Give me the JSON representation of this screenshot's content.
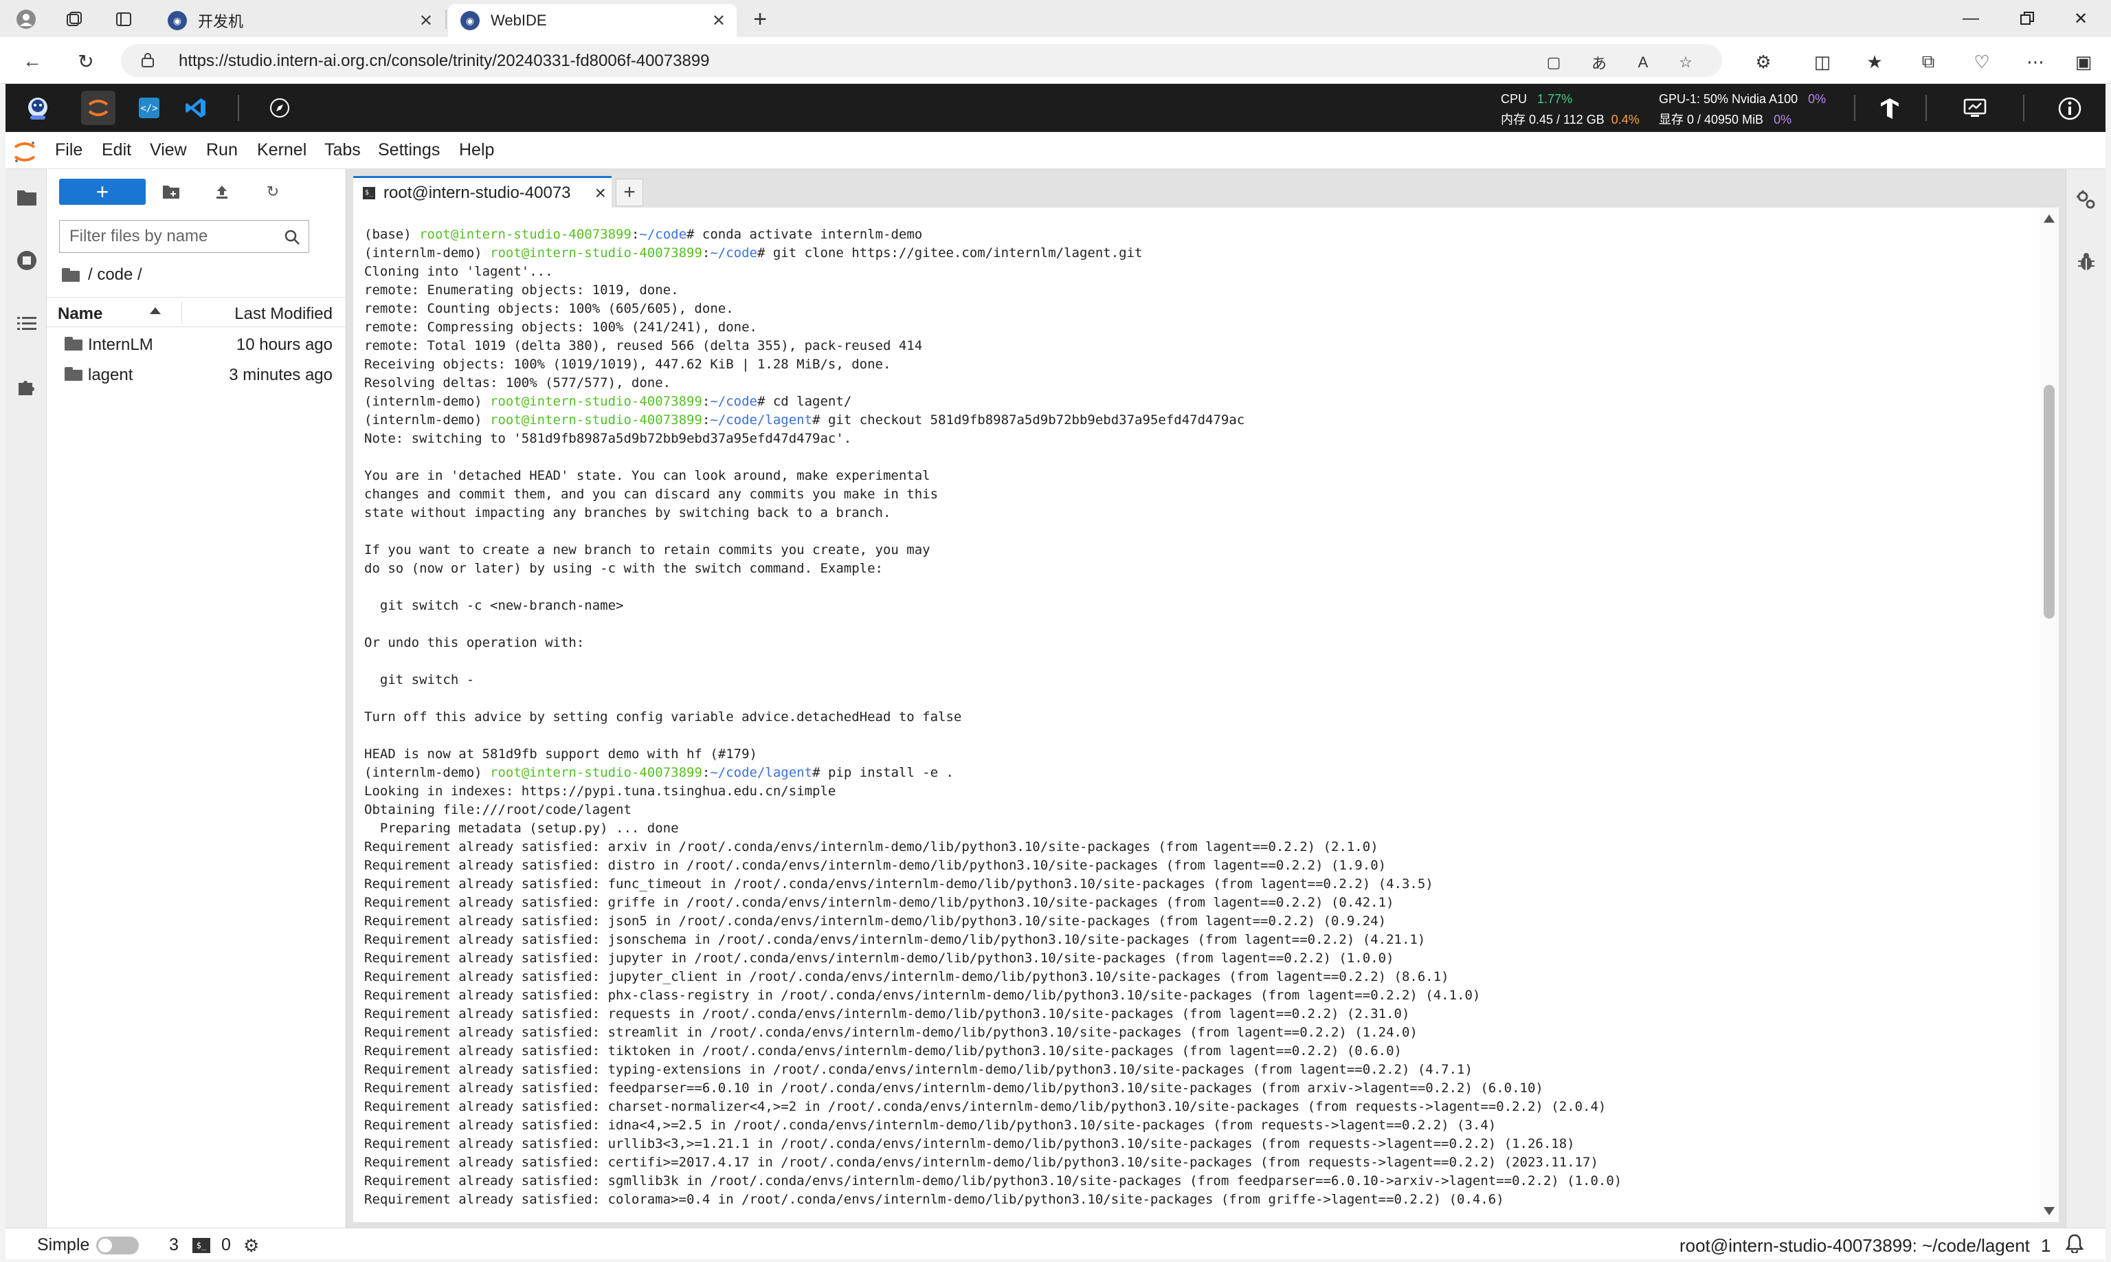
{
  "browser": {
    "tabs": [
      {
        "title": "开发机",
        "active": false
      },
      {
        "title": "WebIDE",
        "active": true
      }
    ],
    "url": "https://studio.intern-ai.org.cn/console/trinity/20240331-fd8006f-40073899"
  },
  "header": {
    "cpu_label": "CPU",
    "cpu_value": "1.77%",
    "mem_label": "内存 0.45 / 112 GB",
    "mem_value": "0.4%",
    "gpu_label": "GPU-1: 50% Nvidia A100",
    "gpu_value": "0%",
    "vram_label": "显存 0 / 40950 MiB",
    "vram_value": "0%"
  },
  "menubar": {
    "items": [
      "File",
      "Edit",
      "View",
      "Run",
      "Kernel",
      "Tabs",
      "Settings",
      "Help"
    ]
  },
  "filebrowser": {
    "new_label": "+",
    "filter_placeholder": "Filter files by name",
    "breadcrumb": "/ code /",
    "col_name": "Name",
    "col_modified": "Last Modified",
    "items": [
      {
        "name": "InternLM",
        "modified": "10 hours ago"
      },
      {
        "name": "lagent",
        "modified": "3 minutes ago"
      }
    ]
  },
  "terminal": {
    "tab_title": "root@intern-studio-40073",
    "lines": [
      [
        {
          "t": "(base) ",
          "c": ""
        },
        {
          "t": "root@intern-studio-40073899",
          "c": "host"
        },
        {
          "t": ":",
          "c": ""
        },
        {
          "t": "~/code",
          "c": "path"
        },
        {
          "t": "# conda activate internlm-demo",
          "c": ""
        }
      ],
      [
        {
          "t": "(internlm-demo) ",
          "c": ""
        },
        {
          "t": "root@intern-studio-40073899",
          "c": "host"
        },
        {
          "t": ":",
          "c": ""
        },
        {
          "t": "~/code",
          "c": "path"
        },
        {
          "t": "# git clone https://gitee.com/internlm/lagent.git",
          "c": ""
        }
      ],
      [
        {
          "t": "Cloning into 'lagent'...",
          "c": ""
        }
      ],
      [
        {
          "t": "remote: Enumerating objects: 1019, done.",
          "c": ""
        }
      ],
      [
        {
          "t": "remote: Counting objects: 100% (605/605), done.",
          "c": ""
        }
      ],
      [
        {
          "t": "remote: Compressing objects: 100% (241/241), done.",
          "c": ""
        }
      ],
      [
        {
          "t": "remote: Total 1019 (delta 380), reused 566 (delta 355), pack-reused 414",
          "c": ""
        }
      ],
      [
        {
          "t": "Receiving objects: 100% (1019/1019), 447.62 KiB | 1.28 MiB/s, done.",
          "c": ""
        }
      ],
      [
        {
          "t": "Resolving deltas: 100% (577/577), done.",
          "c": ""
        }
      ],
      [
        {
          "t": "(internlm-demo) ",
          "c": ""
        },
        {
          "t": "root@intern-studio-40073899",
          "c": "host"
        },
        {
          "t": ":",
          "c": ""
        },
        {
          "t": "~/code",
          "c": "path"
        },
        {
          "t": "# cd lagent/",
          "c": ""
        }
      ],
      [
        {
          "t": "(internlm-demo) ",
          "c": ""
        },
        {
          "t": "root@intern-studio-40073899",
          "c": "host"
        },
        {
          "t": ":",
          "c": ""
        },
        {
          "t": "~/code/lagent",
          "c": "path"
        },
        {
          "t": "# git checkout 581d9fb8987a5d9b72bb9ebd37a95efd47d479ac",
          "c": ""
        }
      ],
      [
        {
          "t": "Note: switching to '581d9fb8987a5d9b72bb9ebd37a95efd47d479ac'.",
          "c": ""
        }
      ],
      [
        {
          "t": "",
          "c": ""
        }
      ],
      [
        {
          "t": "You are in 'detached HEAD' state. You can look around, make experimental",
          "c": ""
        }
      ],
      [
        {
          "t": "changes and commit them, and you can discard any commits you make in this",
          "c": ""
        }
      ],
      [
        {
          "t": "state without impacting any branches by switching back to a branch.",
          "c": ""
        }
      ],
      [
        {
          "t": "",
          "c": ""
        }
      ],
      [
        {
          "t": "If you want to create a new branch to retain commits you create, you may",
          "c": ""
        }
      ],
      [
        {
          "t": "do so (now or later) by using -c with the switch command. Example:",
          "c": ""
        }
      ],
      [
        {
          "t": "",
          "c": ""
        }
      ],
      [
        {
          "t": "  git switch -c <new-branch-name>",
          "c": ""
        }
      ],
      [
        {
          "t": "",
          "c": ""
        }
      ],
      [
        {
          "t": "Or undo this operation with:",
          "c": ""
        }
      ],
      [
        {
          "t": "",
          "c": ""
        }
      ],
      [
        {
          "t": "  git switch -",
          "c": ""
        }
      ],
      [
        {
          "t": "",
          "c": ""
        }
      ],
      [
        {
          "t": "Turn off this advice by setting config variable advice.detachedHead to false",
          "c": ""
        }
      ],
      [
        {
          "t": "",
          "c": ""
        }
      ],
      [
        {
          "t": "HEAD is now at 581d9fb support demo with hf (#179)",
          "c": ""
        }
      ],
      [
        {
          "t": "(internlm-demo) ",
          "c": ""
        },
        {
          "t": "root@intern-studio-40073899",
          "c": "host"
        },
        {
          "t": ":",
          "c": ""
        },
        {
          "t": "~/code/lagent",
          "c": "path"
        },
        {
          "t": "# pip install -e .",
          "c": ""
        }
      ],
      [
        {
          "t": "Looking in indexes: https://pypi.tuna.tsinghua.edu.cn/simple",
          "c": ""
        }
      ],
      [
        {
          "t": "Obtaining file:///root/code/lagent",
          "c": ""
        }
      ],
      [
        {
          "t": "  Preparing metadata (setup.py) ... done",
          "c": ""
        }
      ],
      [
        {
          "t": "Requirement already satisfied: arxiv in /root/.conda/envs/internlm-demo/lib/python3.10/site-packages (from lagent==0.2.2) (2.1.0)",
          "c": ""
        }
      ],
      [
        {
          "t": "Requirement already satisfied: distro in /root/.conda/envs/internlm-demo/lib/python3.10/site-packages (from lagent==0.2.2) (1.9.0)",
          "c": ""
        }
      ],
      [
        {
          "t": "Requirement already satisfied: func_timeout in /root/.conda/envs/internlm-demo/lib/python3.10/site-packages (from lagent==0.2.2) (4.3.5)",
          "c": ""
        }
      ],
      [
        {
          "t": "Requirement already satisfied: griffe in /root/.conda/envs/internlm-demo/lib/python3.10/site-packages (from lagent==0.2.2) (0.42.1)",
          "c": ""
        }
      ],
      [
        {
          "t": "Requirement already satisfied: json5 in /root/.conda/envs/internlm-demo/lib/python3.10/site-packages (from lagent==0.2.2) (0.9.24)",
          "c": ""
        }
      ],
      [
        {
          "t": "Requirement already satisfied: jsonschema in /root/.conda/envs/internlm-demo/lib/python3.10/site-packages (from lagent==0.2.2) (4.21.1)",
          "c": ""
        }
      ],
      [
        {
          "t": "Requirement already satisfied: jupyter in /root/.conda/envs/internlm-demo/lib/python3.10/site-packages (from lagent==0.2.2) (1.0.0)",
          "c": ""
        }
      ],
      [
        {
          "t": "Requirement already satisfied: jupyter_client in /root/.conda/envs/internlm-demo/lib/python3.10/site-packages (from lagent==0.2.2) (8.6.1)",
          "c": ""
        }
      ],
      [
        {
          "t": "Requirement already satisfied: phx-class-registry in /root/.conda/envs/internlm-demo/lib/python3.10/site-packages (from lagent==0.2.2) (4.1.0)",
          "c": ""
        }
      ],
      [
        {
          "t": "Requirement already satisfied: requests in /root/.conda/envs/internlm-demo/lib/python3.10/site-packages (from lagent==0.2.2) (2.31.0)",
          "c": ""
        }
      ],
      [
        {
          "t": "Requirement already satisfied: streamlit in /root/.conda/envs/internlm-demo/lib/python3.10/site-packages (from lagent==0.2.2) (1.24.0)",
          "c": ""
        }
      ],
      [
        {
          "t": "Requirement already satisfied: tiktoken in /root/.conda/envs/internlm-demo/lib/python3.10/site-packages (from lagent==0.2.2) (0.6.0)",
          "c": ""
        }
      ],
      [
        {
          "t": "Requirement already satisfied: typing-extensions in /root/.conda/envs/internlm-demo/lib/python3.10/site-packages (from lagent==0.2.2) (4.7.1)",
          "c": ""
        }
      ],
      [
        {
          "t": "Requirement already satisfied: feedparser==6.0.10 in /root/.conda/envs/internlm-demo/lib/python3.10/site-packages (from arxiv->lagent==0.2.2) (6.0.10)",
          "c": ""
        }
      ],
      [
        {
          "t": "Requirement already satisfied: charset-normalizer<4,>=2 in /root/.conda/envs/internlm-demo/lib/python3.10/site-packages (from requests->lagent==0.2.2) (2.0.4)",
          "c": ""
        }
      ],
      [
        {
          "t": "Requirement already satisfied: idna<4,>=2.5 in /root/.conda/envs/internlm-demo/lib/python3.10/site-packages (from requests->lagent==0.2.2) (3.4)",
          "c": ""
        }
      ],
      [
        {
          "t": "Requirement already satisfied: urllib3<3,>=1.21.1 in /root/.conda/envs/internlm-demo/lib/python3.10/site-packages (from requests->lagent==0.2.2) (1.26.18)",
          "c": ""
        }
      ],
      [
        {
          "t": "Requirement already satisfied: certifi>=2017.4.17 in /root/.conda/envs/internlm-demo/lib/python3.10/site-packages (from requests->lagent==0.2.2) (2023.11.17)",
          "c": ""
        }
      ],
      [
        {
          "t": "Requirement already satisfied: sgmllib3k in /root/.conda/envs/internlm-demo/lib/python3.10/site-packages (from feedparser==6.0.10->arxiv->lagent==0.2.2) (1.0.0)",
          "c": ""
        }
      ],
      [
        {
          "t": "Requirement already satisfied: colorama>=0.4 in /root/.conda/envs/internlm-demo/lib/python3.10/site-packages (from griffe->lagent==0.2.2) (0.4.6)",
          "c": ""
        }
      ]
    ]
  },
  "statusbar": {
    "mode": "Simple",
    "count1": "3",
    "count2": "0",
    "terminal_path": "root@intern-studio-40073899: ~/code/lagent",
    "notif_count": "1"
  },
  "colors": {
    "accent": "#1976d2",
    "prompt_host": "#56c023",
    "prompt_path": "#3b6fd9",
    "header_bg": "#1c1c1c"
  }
}
